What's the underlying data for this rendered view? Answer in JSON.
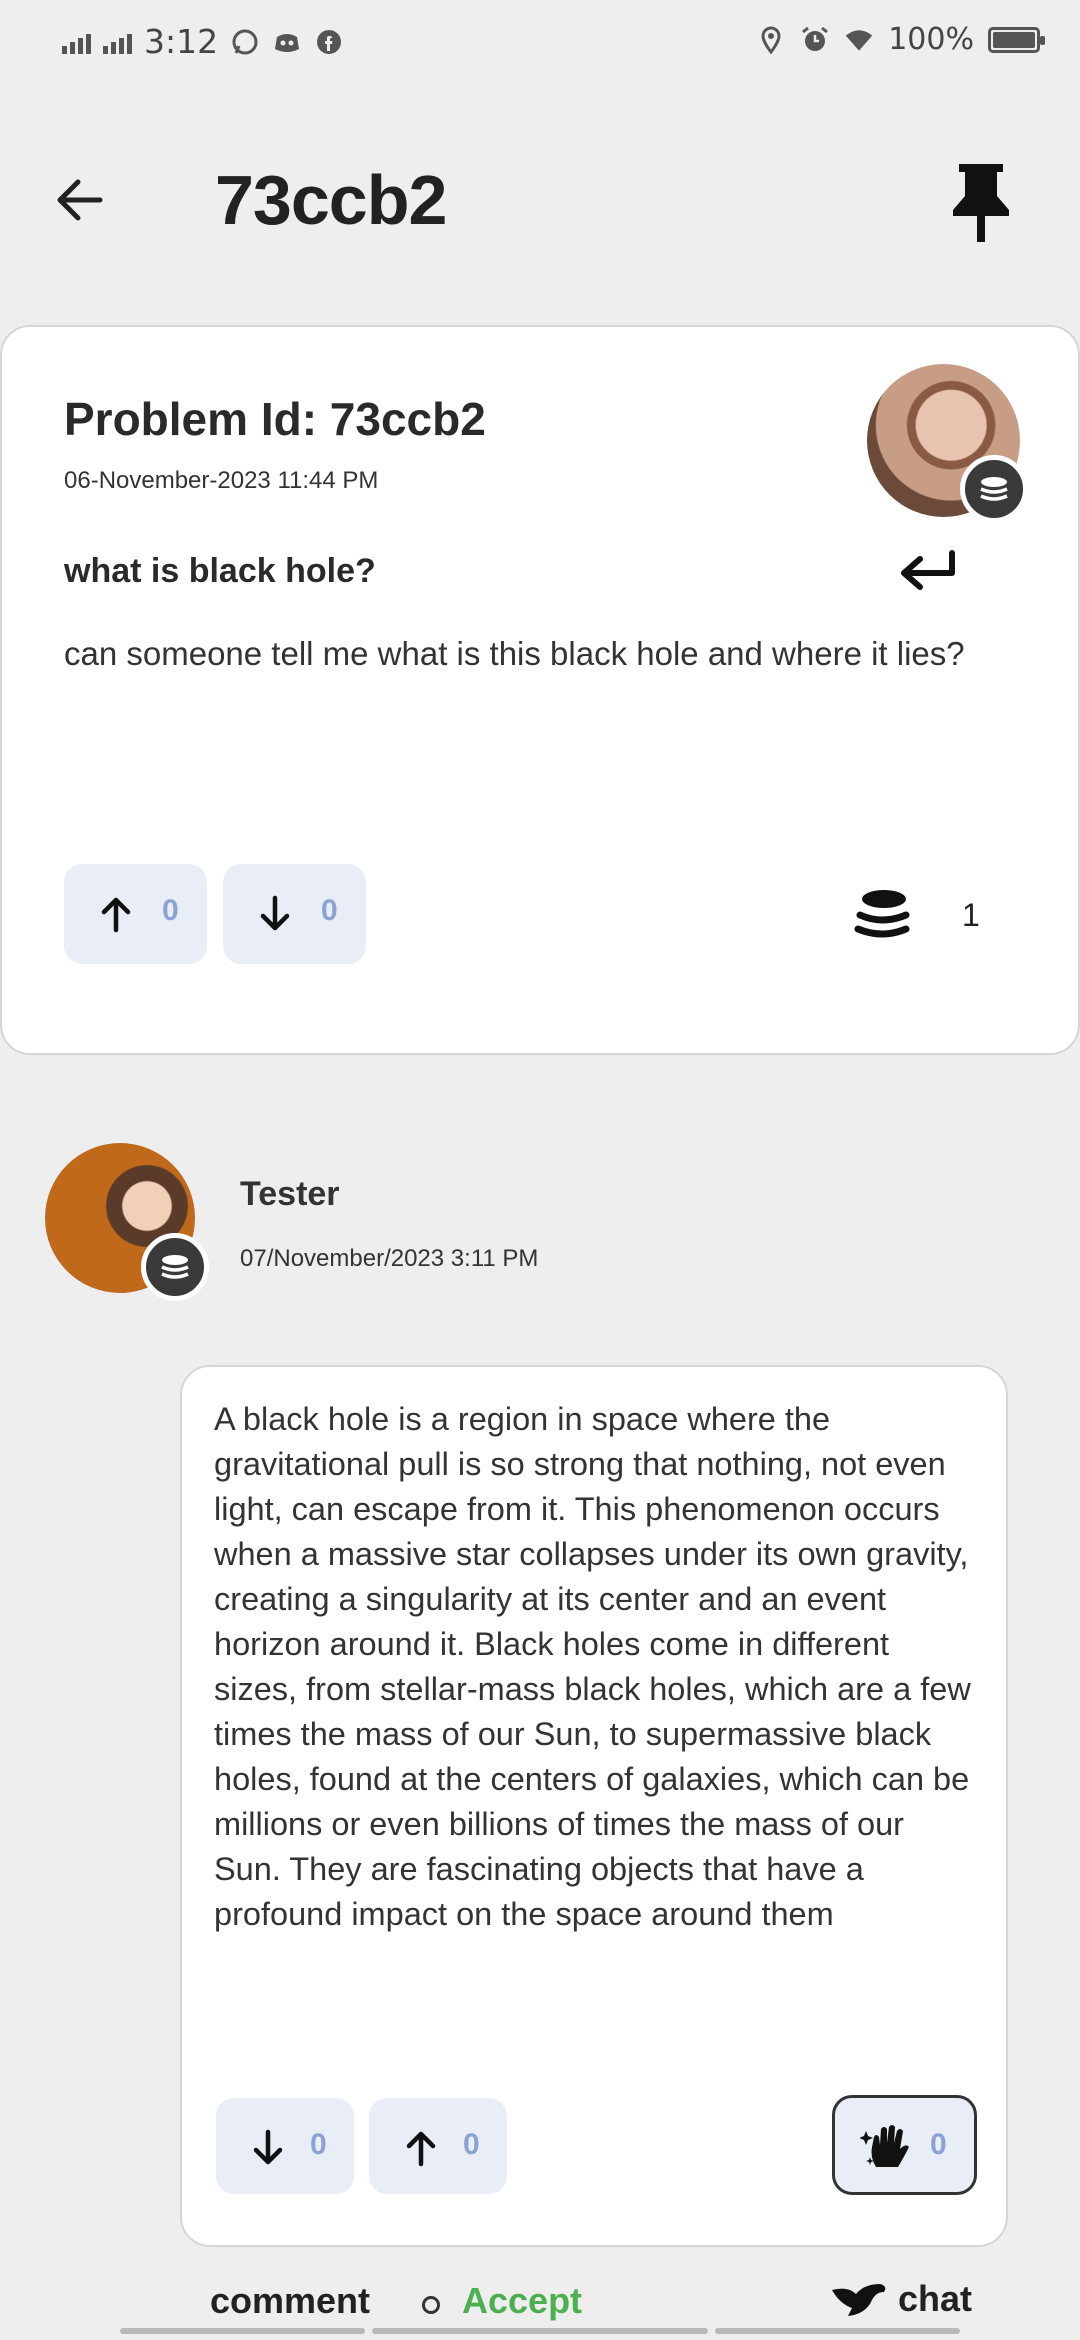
{
  "status_bar": {
    "time": "3:12",
    "battery": "100%",
    "battery_level": 1.0
  },
  "header": {
    "title": "73ccb2",
    "back_icon": "arrow-left-icon",
    "pin_icon": "pin-icon"
  },
  "problem": {
    "title": "Problem Id: 73ccb2",
    "date": "06-November-2023 11:44 PM",
    "question": "what is black hole?",
    "description": "can someone tell me what is this black hole and where it lies?",
    "upvotes": "0",
    "downvotes": "0",
    "coin_count": "1"
  },
  "answer": {
    "author": "Tester",
    "date": "07/November/2023 3:11 PM",
    "text": "A black hole is a region in space where the gravitational pull is so strong that nothing, not even light, can escape from it. This phenomenon occurs when a massive star collapses under its own gravity, creating a singularity at its center and an event horizon around it. Black holes come in different sizes, from stellar-mass black holes, which are a few times the mass of our Sun, to supermassive black holes, found at the centers of galaxies, which can be millions or even billions of times the mass of our Sun. They are fascinating objects that have a profound impact on the space around them",
    "downvotes": "0",
    "upvotes": "0",
    "helpful_count": "0"
  },
  "actions": {
    "comment": "comment",
    "accept": "Accept",
    "chat": "chat"
  },
  "colors": {
    "accept": "#4caf50",
    "vote_count": "#8aa2d4",
    "vote_bg": "#e9edf6"
  }
}
